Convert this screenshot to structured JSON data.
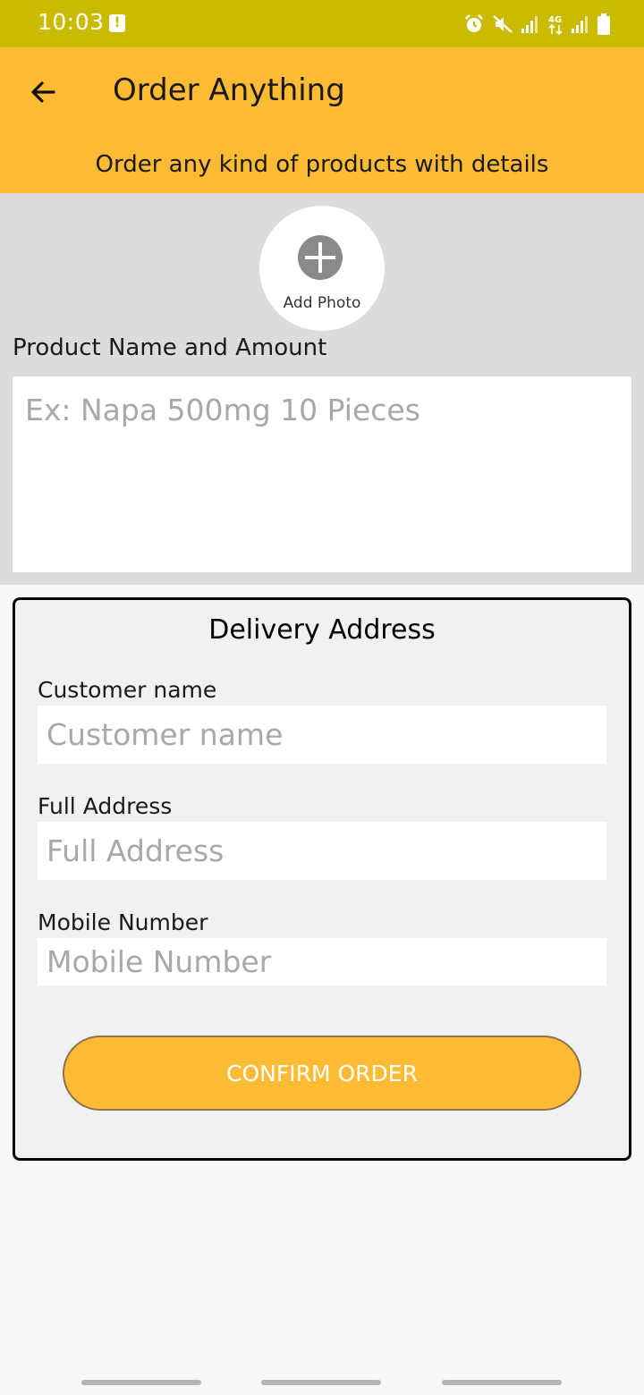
{
  "status_bar": {
    "time": "10:03",
    "icons": [
      "notification-alert-icon",
      "alarm-icon",
      "mute-icon",
      "signal-icon",
      "4g-icon",
      "signal-icon",
      "battery-icon"
    ]
  },
  "app_bar": {
    "back_icon": "arrow-back-icon",
    "title": "Order Anything",
    "subtitle": "Order any kind of products with details"
  },
  "product": {
    "add_photo_label": "Add Photo",
    "label": "Product Name and Amount",
    "placeholder": "Ex: Napa 500mg 10 Pieces",
    "value": ""
  },
  "delivery": {
    "title": "Delivery Address",
    "customer_name": {
      "label": "Customer name",
      "placeholder": "Customer name",
      "value": ""
    },
    "full_address": {
      "label": "Full Address",
      "placeholder": "Full Address",
      "value": ""
    },
    "mobile_number": {
      "label": "Mobile Number",
      "placeholder": "Mobile Number",
      "value": ""
    },
    "confirm_label": "CONFIRM ORDER"
  },
  "colors": {
    "status_bar": "#cbbb00",
    "accent": "#ffbb33",
    "section_bg": "#dcdcdc",
    "card_bg": "#f1f1f1"
  }
}
